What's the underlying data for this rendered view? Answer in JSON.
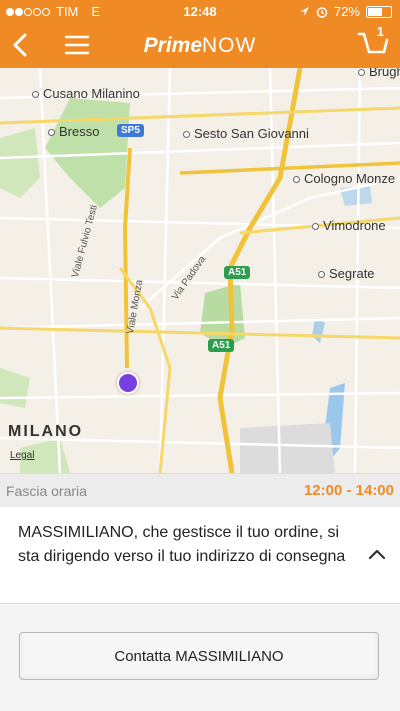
{
  "status_bar": {
    "carrier": "TIM",
    "network": "E",
    "time": "12:48",
    "battery": "72%",
    "battery_level": 0.72
  },
  "navbar": {
    "logo_primary": "Prime",
    "logo_secondary": "NOW",
    "cart_count": "1",
    "color": "#f08a24"
  },
  "map": {
    "places": {
      "cusano": "Cusano Milanino",
      "bresso": "Bresso",
      "sesto": "Sesto San Giovanni",
      "cologno": "Cologno Monze",
      "vimodrone": "Vimodrone",
      "segrate": "Segrate",
      "brug": "Brugh"
    },
    "streets": {
      "testi": "Viale Fulvio Testi",
      "monza": "Viale Monza",
      "padova": "Via Padova"
    },
    "shields": {
      "sp5": "SP5",
      "a51_1": "A51",
      "a51_2": "A51"
    },
    "city": "MILANO",
    "legal": "Legal",
    "location_color": "#7a3fe3"
  },
  "delivery": {
    "slot_label": "Fascia oraria",
    "slot_value": "12:00 - 14:00",
    "message": "MASSIMILIANO, che gestisce il tuo ordine, si sta dirigendo verso il tuo indirizzo di consegna",
    "contact_button": "Contatta MASSIMILIANO"
  }
}
